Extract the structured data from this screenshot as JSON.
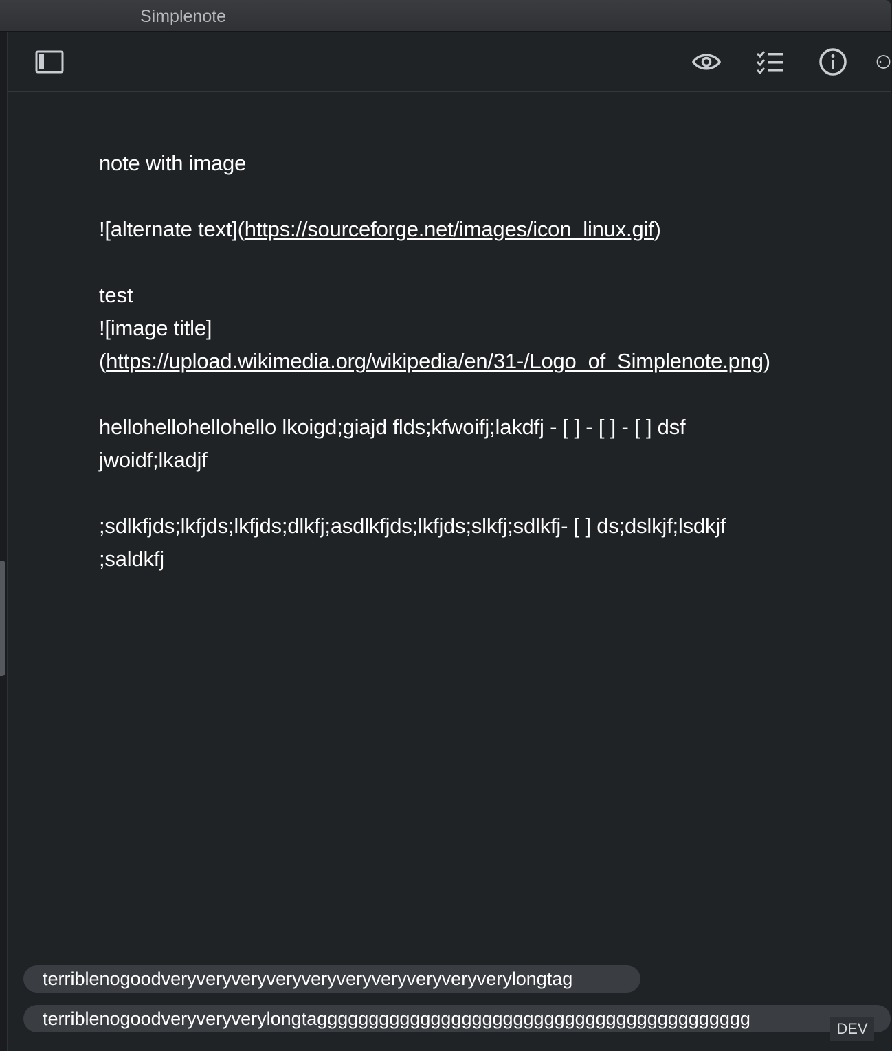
{
  "window": {
    "title": "Simplenote"
  },
  "toolbar": {
    "sidebar_toggle_icon": "sidebar-icon",
    "preview_icon": "eye-icon",
    "checklist_icon": "checklist-icon",
    "info_icon": "info-icon",
    "more_icon": "ellipsis-icon"
  },
  "note": {
    "lines": {
      "l0": "note with image",
      "l2_prefix": "![alternate  text](",
      "l2_link": "https://sourceforge.net/images/icon_linux.gif",
      "l2_suffix": ")",
      "l4": "test",
      "l5": "![image title]",
      "l6_prefix": "(",
      "l6_link": "https://upload.wikimedia.org/wikipedia/en/31-/Logo_of_Simplenote.png",
      "l6_suffix": ")",
      "l8": "hellohellohellohello lkoigd;giajd flds;kfwoifj;lakdfj - [ ] - [ ] - [ ] dsf",
      "l9": "jwoidf;lkadjf",
      "l11": ";sdlkfjds;lkfjds;lkfjds;dlkfj;asdlkfjds;lkfjds;slkfj;sdlkfj- [ ] ds;dslkjf;lsdkjf",
      "l12": ";saldkfj"
    }
  },
  "tags": [
    "terriblenogoodveryveryveryveryveryveryveryveryveryverylongtag",
    "terriblenogoodveryveryverylongtagggggggggggggggggggggggggggggggggggggggggg"
  ],
  "badge": "DEV",
  "colors": {
    "background": "#1f2326",
    "text": "#ffffff",
    "tag_bg": "#3a3e43",
    "icon": "#c9ccd0"
  }
}
